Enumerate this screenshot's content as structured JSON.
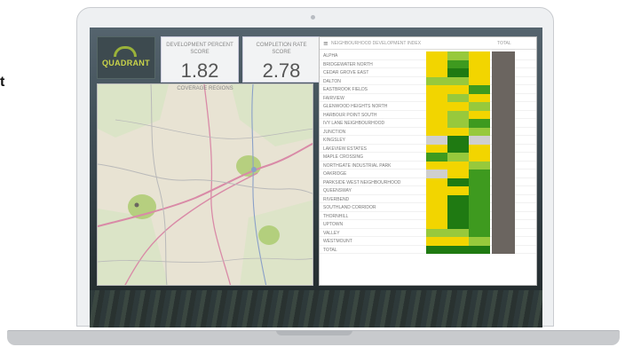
{
  "side_label": "t",
  "dashboard": {
    "logo": {
      "text": "QUADRANT"
    },
    "kpis": [
      {
        "label": "DEVELOPMENT PERCENT SCORE",
        "value": "1.82"
      },
      {
        "label": "COMPLETION RATE SCORE",
        "value": "2.78"
      }
    ],
    "map": {
      "title": "COVERAGE REGIONS"
    },
    "table": {
      "title": "NEIGHBOURHOOD DEVELOPMENT INDEX",
      "columns": [
        "",
        "",
        "",
        "TOTAL"
      ],
      "colors": {
        "yellow": "#f2d500",
        "light": "#97c93c",
        "green": "#3e9a1f",
        "dark": "#1f7a12",
        "grey": "#cfcfcf",
        "olive": "#6b6560"
      },
      "rows": [
        {
          "name": "ALPHA",
          "c": [
            "yellow",
            "light",
            "yellow"
          ]
        },
        {
          "name": "BRIDGEWATER NORTH",
          "c": [
            "yellow",
            "green",
            "yellow"
          ]
        },
        {
          "name": "CEDAR GROVE EAST",
          "c": [
            "yellow",
            "dark",
            "yellow"
          ]
        },
        {
          "name": "DALTON",
          "c": [
            "light",
            "light",
            "yellow"
          ]
        },
        {
          "name": "EASTBROOK FIELDS",
          "c": [
            "yellow",
            "yellow",
            "green"
          ]
        },
        {
          "name": "FAIRVIEW",
          "c": [
            "yellow",
            "light",
            "yellow"
          ]
        },
        {
          "name": "GLENWOOD HEIGHTS NORTH",
          "c": [
            "yellow",
            "yellow",
            "light"
          ]
        },
        {
          "name": "HARBOUR POINT SOUTH",
          "c": [
            "yellow",
            "light",
            "yellow"
          ]
        },
        {
          "name": "IVY LANE NEIGHBOURHOOD",
          "c": [
            "yellow",
            "light",
            "green"
          ]
        },
        {
          "name": "JUNCTION",
          "c": [
            "yellow",
            "yellow",
            "light"
          ]
        },
        {
          "name": "KINGSLEY",
          "c": [
            "grey",
            "dark",
            "grey"
          ]
        },
        {
          "name": "LAKEVIEW ESTATES",
          "c": [
            "yellow",
            "dark",
            "yellow"
          ]
        },
        {
          "name": "MAPLE CROSSING",
          "c": [
            "green",
            "light",
            "yellow"
          ]
        },
        {
          "name": "NORTHGATE INDUSTRIAL PARK",
          "c": [
            "yellow",
            "yellow",
            "light"
          ]
        },
        {
          "name": "OAKRIDGE",
          "c": [
            "grey",
            "yellow",
            "green"
          ]
        },
        {
          "name": "PARKSIDE WEST NEIGHBOURHOOD",
          "c": [
            "yellow",
            "dark",
            "green"
          ]
        },
        {
          "name": "QUEENSWAY",
          "c": [
            "yellow",
            "yellow",
            "green"
          ]
        },
        {
          "name": "RIVERBEND",
          "c": [
            "yellow",
            "dark",
            "green"
          ]
        },
        {
          "name": "SOUTHLAND CORRIDOR",
          "c": [
            "yellow",
            "dark",
            "green"
          ]
        },
        {
          "name": "THORNHILL",
          "c": [
            "yellow",
            "dark",
            "green"
          ]
        },
        {
          "name": "UPTOWN",
          "c": [
            "yellow",
            "dark",
            "green"
          ]
        },
        {
          "name": "VALLEY",
          "c": [
            "light",
            "light",
            "green"
          ]
        },
        {
          "name": "WESTMOUNT",
          "c": [
            "yellow",
            "yellow",
            "light"
          ]
        },
        {
          "name": "TOTAL",
          "c": [
            "dark",
            "dark",
            "dark"
          ]
        }
      ]
    }
  }
}
